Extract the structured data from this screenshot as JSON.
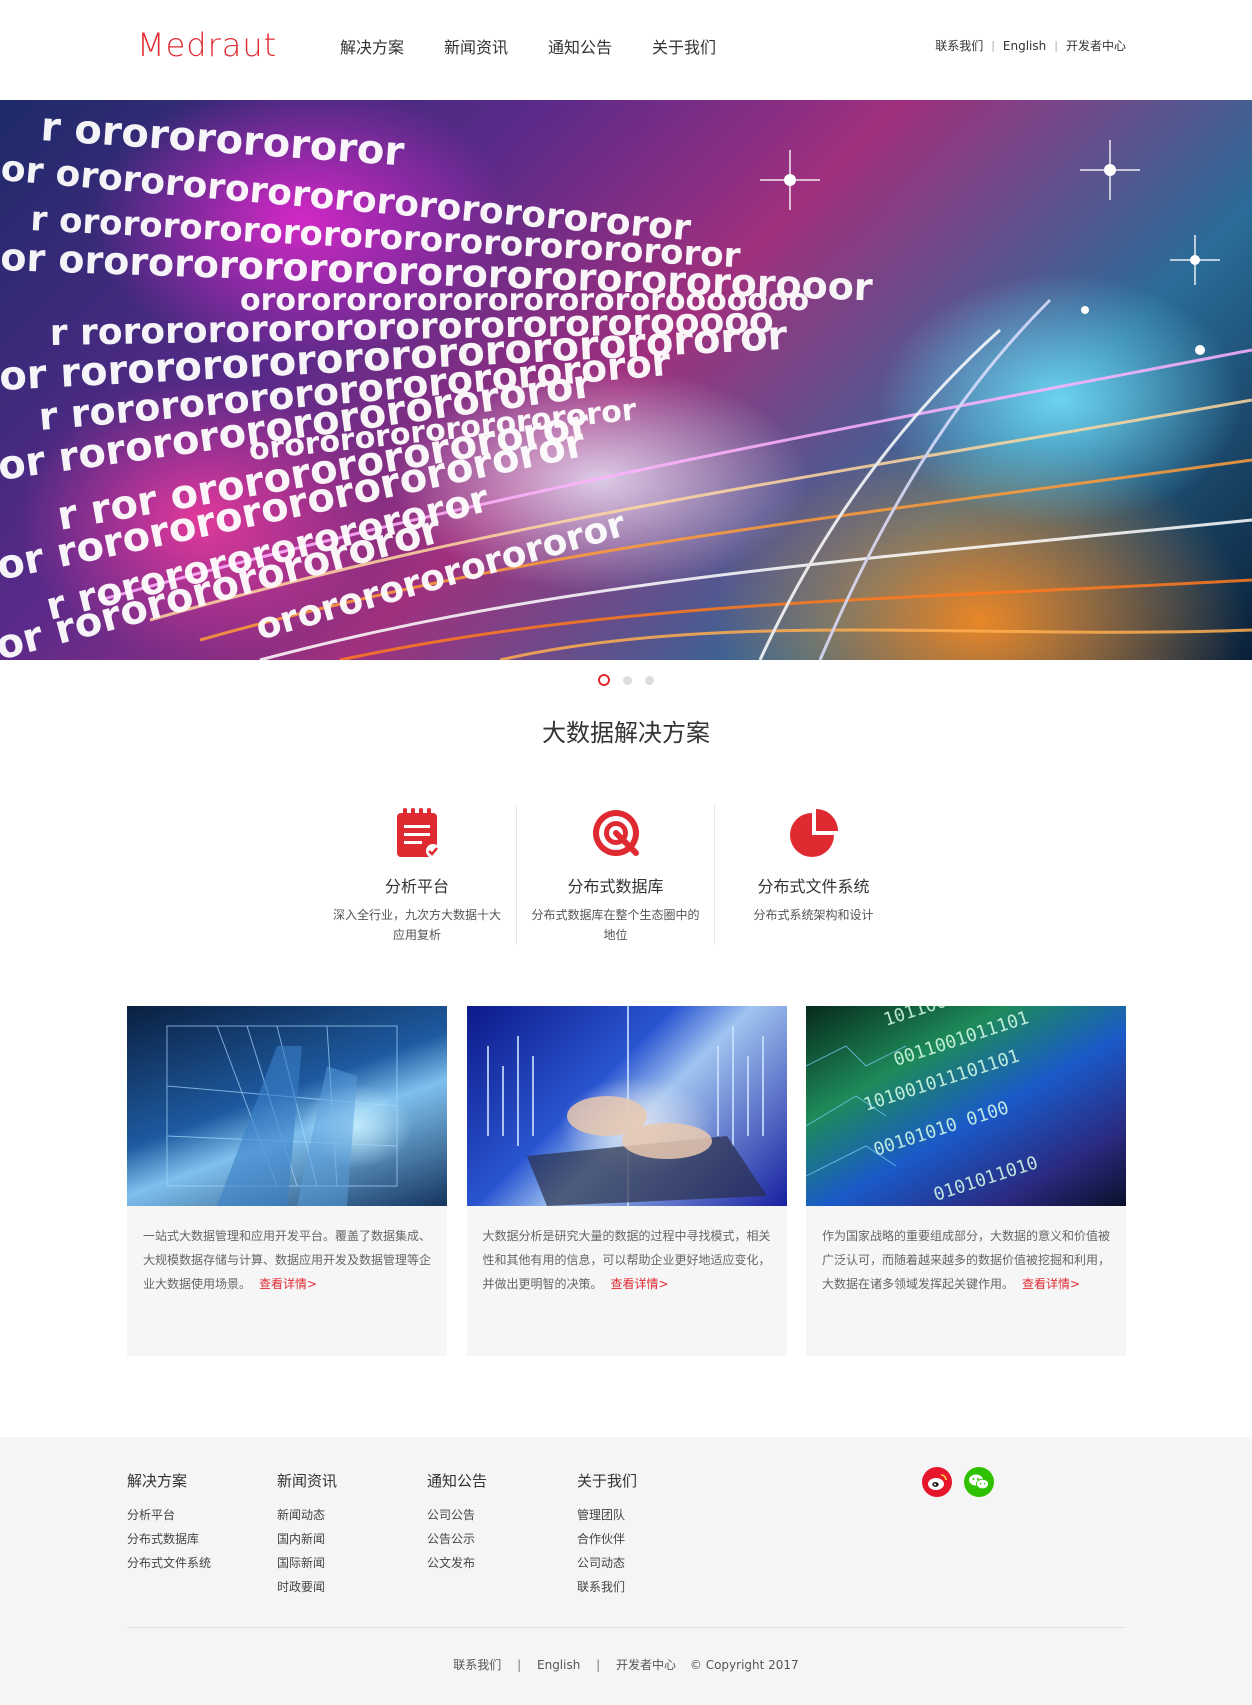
{
  "header": {
    "logo": "Medraut",
    "nav": [
      "解决方案",
      "新闻资讯",
      "通知公告",
      "关于我们"
    ],
    "toplinks": [
      "联系我们",
      "English",
      "开发者中心"
    ]
  },
  "banner": {
    "slides_total": 3,
    "active_slide": 1
  },
  "section_title": "大数据解决方案",
  "features": [
    {
      "icon": "clipboard-icon",
      "name": "分析平台",
      "desc": "深入全行业，九次方大数据十大应用复析"
    },
    {
      "icon": "target-icon",
      "name": "分布式数据库",
      "desc": "分布式数据库在整个生态圈中的地位"
    },
    {
      "icon": "pie-chart-icon",
      "name": "分布式文件系统",
      "desc": "分布式系统架构和设计"
    }
  ],
  "cards": [
    {
      "text": "一站式大数据管理和应用开发平台。覆盖了数据集成、大规模数据存储与计算、数据应用开发及数据管理等企业大数据使用场景。",
      "more": "查看详情>"
    },
    {
      "text": "大数据分析是研究大量的数据的过程中寻找模式，相关性和其他有用的信息，可以帮助企业更好地适应变化，并做出更明智的决策。",
      "more": "查看详情>"
    },
    {
      "text": "作为国家战略的重要组成部分，大数据的意义和价值被广泛认可，而随着越来越多的数据价值被挖掘和利用，大数据在诸多领域发挥起关键作用。",
      "more": "查看详情>"
    }
  ],
  "footer": {
    "columns": [
      {
        "title": "解决方案",
        "links": [
          "分析平台",
          "分布式数据库",
          "分布式文件系统"
        ]
      },
      {
        "title": "新闻资讯",
        "links": [
          "新闻动态",
          "国内新闻",
          "国际新闻",
          "时政要闻"
        ]
      },
      {
        "title": "通知公告",
        "links": [
          "公司公告",
          "公告公示",
          "公文发布"
        ]
      },
      {
        "title": "关于我们",
        "links": [
          "管理团队",
          "合作伙伴",
          "公司动态",
          "联系我们"
        ]
      }
    ],
    "social": [
      "weibo-icon",
      "wechat-icon"
    ],
    "bottom_links": [
      "联系我们",
      "English",
      "开发者中心"
    ],
    "copyright": "© Copyright 2017"
  },
  "colors": {
    "brand": "#e02a31",
    "footer_bg": "#f5f5f5",
    "card_bg": "#f6f6f6",
    "weibo": "#e6162d",
    "wechat": "#2dc100"
  }
}
